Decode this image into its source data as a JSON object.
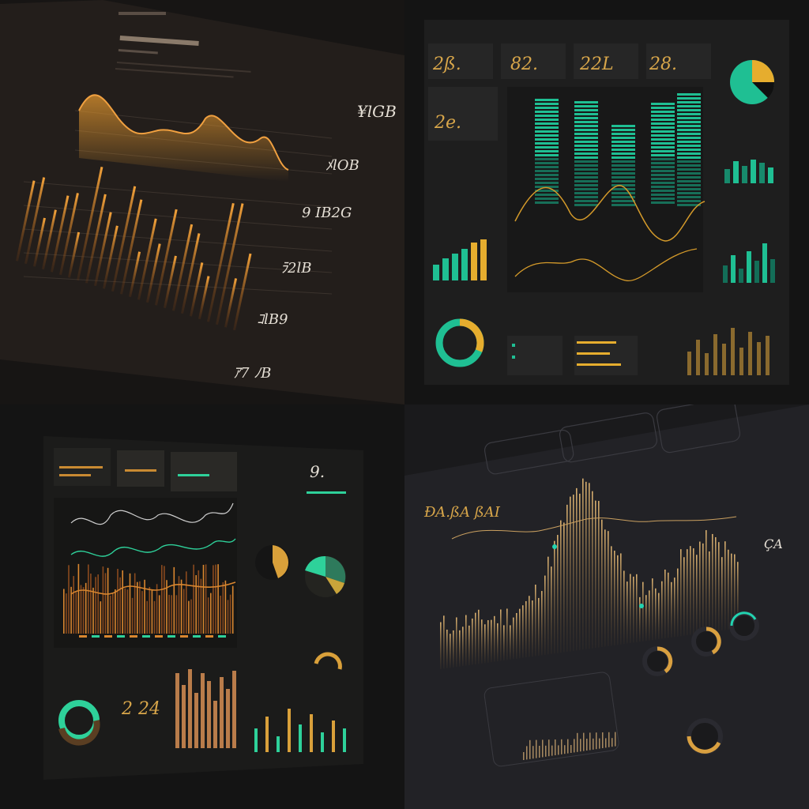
{
  "panel1": {
    "stats": [
      "¥lGB",
      "ﾒlOB",
      "9 IB2G",
      "ﾗ2lB",
      "ｺlB9",
      "ｱ7 ﾉB"
    ],
    "colors": {
      "accent": "#e0952e",
      "bg": "#231e1b"
    }
  },
  "panel2": {
    "kpis": [
      "2ß.",
      "82.",
      "22L",
      "28."
    ],
    "side_kpi": "2e.",
    "colors": {
      "green": "#1fbf93",
      "gold": "#e6ad2e",
      "bg": "#1e1e1e"
    }
  },
  "panel3": {
    "big_number": "9.",
    "kpi": "2 24",
    "colors": {
      "green": "#2ed19a",
      "orange": "#d9862f",
      "bg": "#1b1b1a"
    }
  },
  "panel4": {
    "title": "ÐA.ßA ßAI",
    "stat": "ÇA",
    "colors": {
      "gold": "#caa060",
      "teal": "#22d3b0",
      "bg": "#222226"
    }
  }
}
